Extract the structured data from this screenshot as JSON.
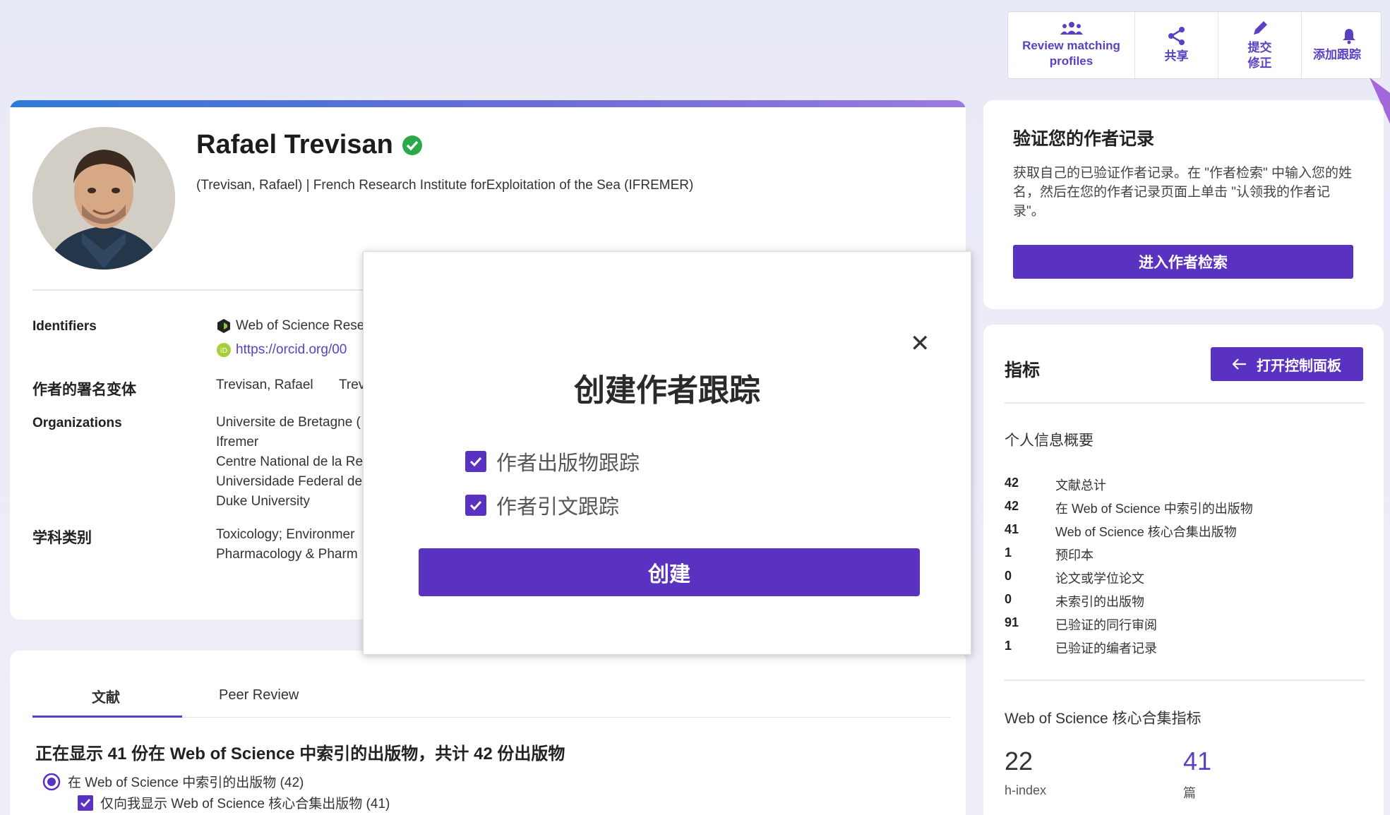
{
  "toolbar": {
    "review_label": "Review matching profiles",
    "share_label": "共享",
    "submit_line1": "提交",
    "submit_line2": "修正",
    "track_label": "添加跟踪"
  },
  "profile": {
    "name": "Rafael Trevisan",
    "affiliation": "(Trevisan, Rafael) | French Research Institute forExploitation of the Sea (IFREMER)",
    "identifiers_label": "Identifiers",
    "identifier_wos": "Web of Science Rese",
    "identifier_orcid": "https://orcid.org/00",
    "name_variants_label": "作者的署名变体",
    "name_variant_1": "Trevisan, Rafael",
    "name_variant_2": "Trev",
    "organizations_label": "Organizations",
    "organizations": [
      "Universite de Bretagne (",
      "Ifremer",
      "Centre National de la Re",
      "Universidade Federal de",
      "Duke University"
    ],
    "subjects_label": "学科类别",
    "subject_line1": "Toxicology;  Environmer",
    "subject_line2": "Pharmacology & Pharm"
  },
  "verify": {
    "title": "验证您的作者记录",
    "text": "获取自己的已验证作者记录。在 \"作者检索\" 中输入您的姓名，然后在您的作者记录页面上单击 \"认领我的作者记录\"。",
    "button": "进入作者检索"
  },
  "metrics": {
    "title": "指标",
    "button": "打开控制面板",
    "overview_label": "个人信息概要",
    "rows": [
      {
        "num": "42",
        "label": "文献总计"
      },
      {
        "num": "42",
        "label": "在 Web of Science 中索引的出版物"
      },
      {
        "num": "41",
        "label": "Web of Science 核心合集出版物"
      },
      {
        "num": "1",
        "label": "预印本"
      },
      {
        "num": "0",
        "label": "论文或学位论文"
      },
      {
        "num": "0",
        "label": "未索引的出版物"
      },
      {
        "num": "91",
        "label": "已验证的同行审阅"
      },
      {
        "num": "1",
        "label": "已验证的编者记录"
      }
    ],
    "core_label": "Web of Science 核心合集指标",
    "h_index_value": "22",
    "h_index_label": "h-index",
    "pubs_value": "41",
    "pubs_label": "篇"
  },
  "documents": {
    "tab_docs": "文献",
    "tab_peer": "Peer Review",
    "showing": "正在显示 41 份在 Web of Science 中索引的出版物，共计 42 份出版物",
    "radio_label": "在 Web of Science 中索引的出版物 (42)",
    "check_label": "仅向我显示 Web of Science 核心合集出版物 (41)"
  },
  "modal": {
    "title": "创建作者跟踪",
    "option1": "作者出版物跟踪",
    "option2": "作者引文跟踪",
    "create_button": "创建",
    "close_symbol": "✕"
  },
  "colors": {
    "brand": "#5a32c2",
    "verified": "#2aa84a"
  }
}
